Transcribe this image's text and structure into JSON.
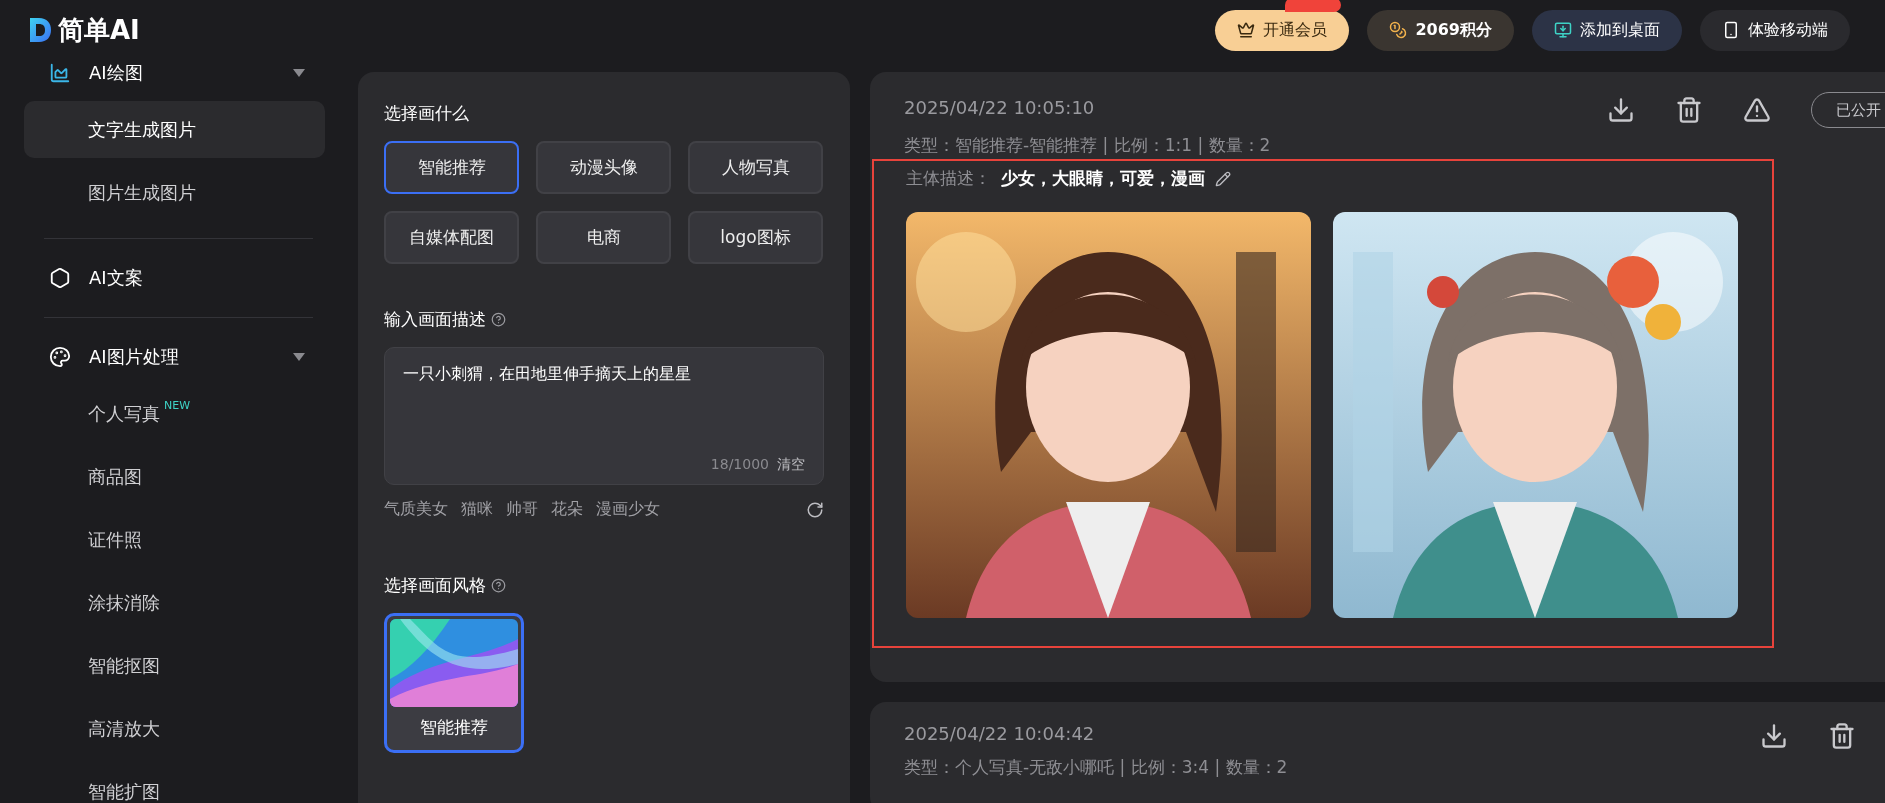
{
  "header": {
    "logo_text": "简单AI",
    "buttons": [
      {
        "kind": "vip",
        "label": "开通会员"
      },
      {
        "kind": "points",
        "label": "2069积分"
      },
      {
        "kind": "desktop",
        "label": "添加到桌面"
      },
      {
        "kind": "mobile",
        "label": "体验移动端"
      }
    ]
  },
  "sidebar": {
    "groups": [
      {
        "kind": "drawing",
        "label": "AI绘图",
        "expanded": true,
        "items": [
          {
            "label": "文字生成图片",
            "selected": true
          },
          {
            "label": "图片生成图片",
            "selected": false
          }
        ]
      },
      {
        "kind": "copy",
        "label": "AI文案"
      },
      {
        "label": "AI图片处理",
        "expanded": true,
        "items": [
          {
            "label": "个人写真",
            "badge": "NEW",
            "selected": false
          },
          {
            "label": "商品图",
            "selected": false
          },
          {
            "label": "证件照",
            "selected": false
          },
          {
            "label": "涂抹消除",
            "selected": false
          },
          {
            "label": "智能抠图",
            "selected": false
          },
          {
            "label": "高清放大",
            "selected": false
          },
          {
            "label": "智能扩图",
            "selected": false
          }
        ]
      }
    ]
  },
  "form": {
    "subject": {
      "title": "选择画什么",
      "options": [
        {
          "label": "智能推荐",
          "selected": true
        },
        {
          "label": "动漫头像",
          "selected": false
        },
        {
          "label": "人物写真",
          "selected": false
        },
        {
          "label": "自媒体配图",
          "selected": false
        },
        {
          "label": "电商",
          "selected": false
        },
        {
          "label": "logo图标",
          "selected": false
        }
      ]
    },
    "description": {
      "title": "输入画面描述",
      "value": "一只小刺猬，在田地里伸手摘天上的星星",
      "counter": "18/1000",
      "clear": "清空",
      "suggestions": [
        "气质美女",
        "猫咪",
        "帅哥",
        "花朵",
        "漫画少女"
      ]
    },
    "style": {
      "title": "选择画面风格",
      "options": [
        {
          "label": "智能推荐",
          "selected": true
        }
      ]
    }
  },
  "records": [
    {
      "time": "2025/04/22 10:05:10",
      "actions": [
        {
          "kind": "download"
        },
        {
          "kind": "delete"
        },
        {
          "kind": "report"
        }
      ],
      "public_label": "已公开",
      "meta": "类型：智能推荐-智能推荐 | 比例：1:1 | 数量：2",
      "subject_label": "主体描述：",
      "subject": "少女，大眼睛，可爱，漫画",
      "highlighted": true,
      "images": [
        {
          "kind": "picture"
        },
        {
          "kind": "picture"
        }
      ]
    },
    {
      "time": "2025/04/22 10:04:42",
      "actions": [
        {
          "kind": "download"
        },
        {
          "kind": "delete"
        }
      ],
      "meta": "类型：个人写真-无敌小哪吒 | 比例：3:4 | 数量：2"
    }
  ]
}
